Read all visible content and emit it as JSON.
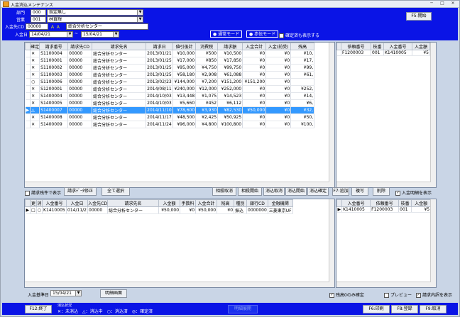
{
  "window": {
    "title": "入金消込メンテナンス"
  },
  "header": {
    "bumon_label": "部門",
    "bumon_code": "000",
    "bumon_name": "指定無し",
    "eigyo_label": "営業",
    "eigyo_code": "001",
    "eigyo_name": "林直輝",
    "nyukinsaki_label": "入金先CD",
    "nyukinsaki_code": "00000",
    "nyukinsaki_name": "総合分析センター",
    "nyukinbi_label": "入金日",
    "date_from": "14/04/21",
    "date_sep": "~",
    "date_to": "15/04/21",
    "mode_normal": "通常モード",
    "mode_akaden": "赤伝モード",
    "show_done_label": "確定済も表示する",
    "f5_label": "F5:開始"
  },
  "seikyu_grid": {
    "columns": [
      "",
      "確定",
      "請求番号",
      "請求先CD",
      "請求先名",
      "請求日",
      "値引後計",
      "消費税",
      "請求額",
      "入金合計",
      "入金(前受)",
      "残高"
    ],
    "rows": [
      [
        "",
        "✕",
        "S1100004",
        "00000",
        "総合分析センター",
        "2013/01/21",
        "¥10,000",
        "¥500",
        "¥10,500",
        "¥0",
        "¥0",
        "¥10,"
      ],
      [
        "",
        "✕",
        "S1100001",
        "00000",
        "総合分析センター",
        "2013/01/25",
        "¥17,000",
        "¥850",
        "¥17,850",
        "¥0",
        "¥0",
        "¥17,"
      ],
      [
        "",
        "✕",
        "S1100002",
        "00000",
        "総合分析センター",
        "2013/01/25",
        "¥95,000",
        "¥4,750",
        "¥99,750",
        "¥0",
        "¥0",
        "¥99,"
      ],
      [
        "",
        "✕",
        "S1100003",
        "00000",
        "総合分析センター",
        "2013/01/25",
        "¥58,180",
        "¥2,908",
        "¥61,088",
        "¥0",
        "¥0",
        "¥61,"
      ],
      [
        "",
        "○",
        "S1100006",
        "00000",
        "総合分析センター",
        "2013/02/23",
        "¥144,000",
        "¥7,200",
        "¥151,200",
        "¥151,200",
        "¥0",
        ""
      ],
      [
        "",
        "✕",
        "S1200001",
        "00000",
        "総合分析センター",
        "2014/08/11",
        "¥240,000",
        "¥12,000",
        "¥252,000",
        "¥0",
        "¥0",
        "¥252,"
      ],
      [
        "",
        "✕",
        "S1400004",
        "00000",
        "総合分析センター",
        "2014/10/03",
        "¥13,448",
        "¥1,075",
        "¥14,523",
        "¥0",
        "¥0",
        "¥14,"
      ],
      [
        "",
        "✕",
        "S1400005",
        "00000",
        "総合分析センター",
        "2014/10/03",
        "¥5,660",
        "¥452",
        "¥6,112",
        "¥0",
        "¥0",
        "¥6,"
      ],
      [
        "▶",
        "△",
        "S1400007",
        "00000",
        "総合分析センター",
        "2014/11/10",
        "¥78,600",
        "¥3,930",
        "¥82,530",
        "¥50,000",
        "¥0",
        "¥32,"
      ],
      [
        "",
        "✕",
        "S1400008",
        "00000",
        "総合分析センター",
        "2014/11/17",
        "¥48,500",
        "¥2,425",
        "¥50,925",
        "¥0",
        "¥0",
        "¥50,"
      ],
      [
        "",
        "✕",
        "S1400009",
        "00000",
        "総合分析センター",
        "2014/11/24",
        "¥96,000",
        "¥4,800",
        "¥100,800",
        "¥0",
        "¥0",
        "¥100,"
      ]
    ]
  },
  "right_grid_top": {
    "columns": [
      "",
      "依頼番号",
      "枝番",
      "入金番号",
      "入金額"
    ],
    "rows": [
      [
        "",
        "F1200003",
        "001",
        "K1410005",
        "¥5"
      ]
    ]
  },
  "mid_toolbar": {
    "show_all_label": "請求残件で表示",
    "edit_label": "請求ﾃﾞｰﾀ修正",
    "select_all_label": "全て選択",
    "cancel_corr_label": "相殺取消",
    "corr_start_label": "相殺開始",
    "keshi_cancel_label": "消込取消",
    "keshi_start_label": "消込開始",
    "keshi_confirm_label": "消込確定",
    "f7_label": "F7:追加",
    "copy_label": "複写",
    "delete_label": "削除",
    "show_detail_label": "入金明細を表示"
  },
  "nyukin_grid": {
    "columns": [
      "",
      "更",
      "消",
      "入金番号",
      "入金日",
      "入金先CD",
      "請求先名",
      "入金額",
      "手数料",
      "入金合計",
      "残高",
      "種別",
      "銀行CD",
      "金融機関"
    ],
    "rows": [
      [
        "▶",
        "□",
        "○",
        "K1410005",
        "014/11/2",
        "00000",
        "総合分析センター",
        "¥50,000",
        "¥0",
        "¥50,000",
        "¥0",
        "振込",
        "0000000",
        "三菱東京UF"
      ]
    ]
  },
  "right_grid_bottom": {
    "columns": [
      "",
      "入金番号",
      "依頼番号",
      "枝番",
      "入金額"
    ],
    "rows": [
      [
        "▶",
        "K1410005",
        "F1200003",
        "001",
        "¥5"
      ]
    ]
  },
  "bottom_bar": {
    "kijunbi_label": "入金基準日",
    "kijunbi_value": "15/04/21",
    "detail_btn": "明細画面",
    "zero_confirm_label": "残高0のみ確定",
    "preview_label": "プレビュー",
    "seikyu_detail_label": "請求内訳を表示"
  },
  "footer": {
    "f12_label": "F12:終了",
    "legend_title": "消込状況",
    "legend_text": "✕：未消込　△：消込中　○：消込済　◎：確定済",
    "center_label": "明細展開",
    "f6_label": "F6:印刷",
    "f8_label": "F8:登録",
    "f9_label": "F9:取消"
  }
}
